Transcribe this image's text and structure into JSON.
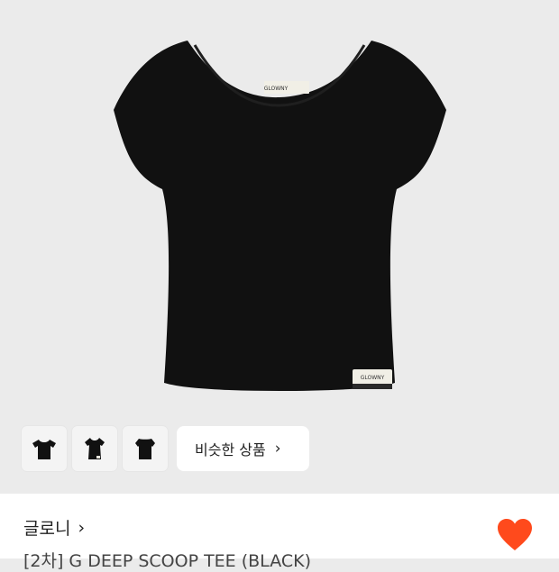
{
  "product": {
    "label_brand": "GLOWNY",
    "hem_tag_brand": "GLOWNY"
  },
  "thumbnails": [
    {
      "icon": "tee-front-icon"
    },
    {
      "icon": "tee-worn-icon"
    },
    {
      "icon": "tee-back-icon"
    }
  ],
  "similar_button": {
    "label": "비슷한 상품",
    "chevron": "›"
  },
  "brand": {
    "name": "글로니",
    "chevron": "›"
  },
  "product_title": "[2차] G DEEP SCOOP TEE (BLACK)",
  "wishlist": {
    "icon": "heart-icon",
    "color": "#ff4a1c"
  },
  "colors": {
    "hero_bg": "#ebebeb",
    "shirt": "#111111",
    "accent": "#ff4a1c"
  }
}
